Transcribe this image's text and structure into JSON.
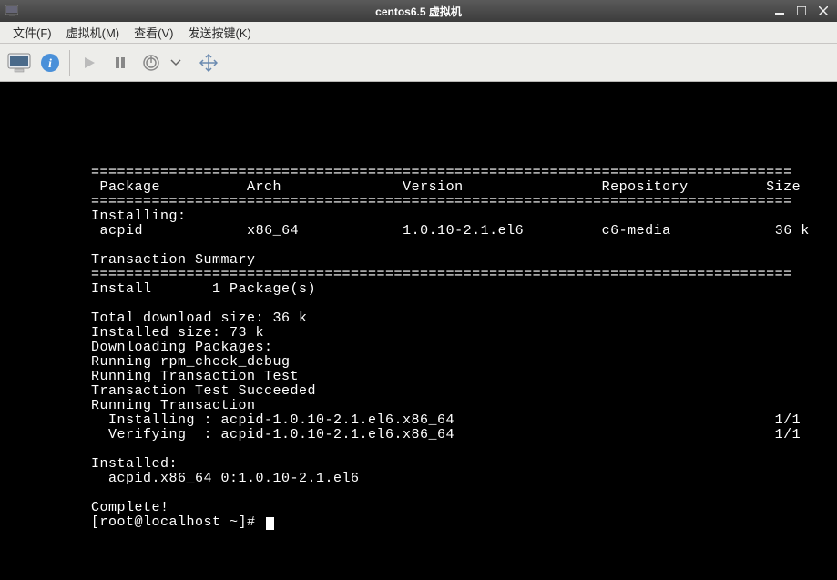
{
  "titlebar": {
    "title": "centos6.5 虚拟机"
  },
  "menubar": {
    "items": [
      "文件(F)",
      "虚拟机(M)",
      "查看(V)",
      "发送按键(K)"
    ]
  },
  "terminal": {
    "divider": "=================================================================================",
    "headers": {
      "package": "Package",
      "arch": "Arch",
      "version": "Version",
      "repository": "Repository",
      "size": "Size"
    },
    "installing_label": "Installing:",
    "package_row": {
      "name": "acpid",
      "arch": "x86_64",
      "version": "1.0.10-2.1.el6",
      "repo": "c6-media",
      "size": "36 k"
    },
    "transaction_summary": "Transaction Summary",
    "install_summary": "Install       1 Package(s)",
    "total_download": "Total download size: 36 k",
    "installed_size": "Installed size: 73 k",
    "downloading": "Downloading Packages:",
    "rpm_check": "Running rpm_check_debug",
    "running_test": "Running Transaction Test",
    "test_succeeded": "Transaction Test Succeeded",
    "running_transaction": "Running Transaction",
    "installing_line": "  Installing : acpid-1.0.10-2.1.el6.x86_64",
    "verifying_line": "  Verifying  : acpid-1.0.10-2.1.el6.x86_64",
    "progress": "1/1",
    "installed_label": "Installed:",
    "installed_pkg": "  acpid.x86_64 0:1.0.10-2.1.el6",
    "complete": "Complete!",
    "prompt": "[root@localhost ~]# "
  }
}
